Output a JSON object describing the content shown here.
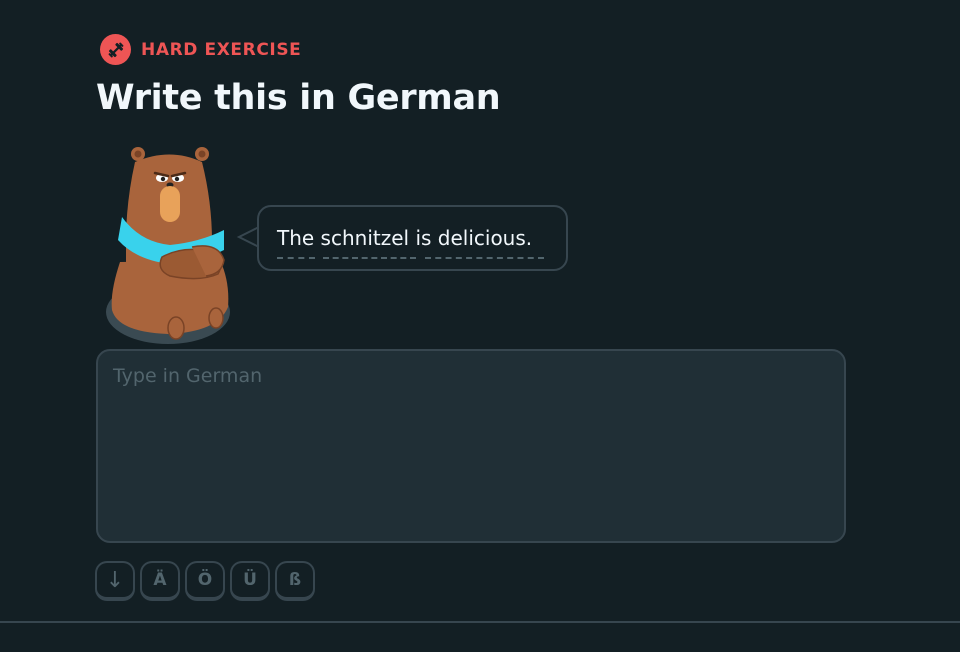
{
  "header": {
    "badge_icon": "dumbbell-icon",
    "badge_label": "HARD EXERCISE",
    "badge_color": "#ee5555",
    "title": "Write this in German"
  },
  "prompt": {
    "character": "bear",
    "sentence": "The schnitzel is delicious."
  },
  "answer": {
    "placeholder": "Type in German",
    "value": ""
  },
  "special_keys": [
    {
      "label": "↓",
      "icon": "arrow-down-icon"
    },
    {
      "label": "Ä"
    },
    {
      "label": "Ö"
    },
    {
      "label": "Ü"
    },
    {
      "label": "ß"
    }
  ],
  "colors": {
    "background": "#131f24",
    "border": "#37464f",
    "input_bg": "#202f36",
    "muted": "#52656d",
    "text": "#f1f7fb",
    "accent": "#ee5555"
  }
}
